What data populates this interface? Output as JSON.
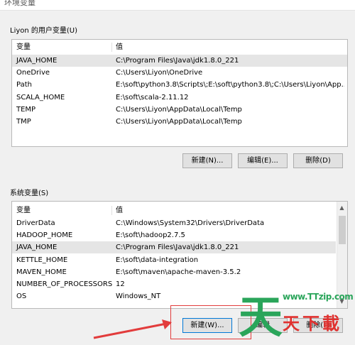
{
  "window": {
    "title": "环境变量"
  },
  "user_vars": {
    "group_label": "Liyon 的用户变量(U)",
    "headers": {
      "name": "变量",
      "value": "值"
    },
    "rows": [
      {
        "name": "JAVA_HOME",
        "value": "C:\\Program Files\\Java\\jdk1.8.0_221",
        "selected": true
      },
      {
        "name": "OneDrive",
        "value": "C:\\Users\\Liyon\\OneDrive",
        "selected": false
      },
      {
        "name": "Path",
        "value": "E:\\soft\\python3.8\\Scripts\\;E:\\soft\\python3.8\\;C:\\Users\\Liyon\\App...",
        "selected": false
      },
      {
        "name": "SCALA_HOME",
        "value": "E:\\soft\\scala-2.11.12",
        "selected": false
      },
      {
        "name": "TEMP",
        "value": "C:\\Users\\Liyon\\AppData\\Local\\Temp",
        "selected": false
      },
      {
        "name": "TMP",
        "value": "C:\\Users\\Liyon\\AppData\\Local\\Temp",
        "selected": false
      }
    ],
    "buttons": {
      "new": "新建(N)...",
      "edit": "编辑(E)...",
      "delete": "删除(D)"
    }
  },
  "system_vars": {
    "group_label": "系统变量(S)",
    "headers": {
      "name": "变量",
      "value": "值"
    },
    "rows": [
      {
        "name": "DriverData",
        "value": "C:\\Windows\\System32\\Drivers\\DriverData",
        "selected": false
      },
      {
        "name": "HADOOP_HOME",
        "value": "E:\\soft\\hadoop2.7.5",
        "selected": false
      },
      {
        "name": "JAVA_HOME",
        "value": "C:\\Program Files\\Java\\jdk1.8.0_221",
        "selected": true
      },
      {
        "name": "KETTLE_HOME",
        "value": "E:\\soft\\data-integration",
        "selected": false
      },
      {
        "name": "MAVEN_HOME",
        "value": "E:\\soft\\maven\\apache-maven-3.5.2",
        "selected": false
      },
      {
        "name": "NUMBER_OF_PROCESSORS",
        "value": "12",
        "selected": false
      },
      {
        "name": "OS",
        "value": "Windows_NT",
        "selected": false
      }
    ],
    "buttons": {
      "new": "新建(W)...",
      "edit": "编辑",
      "delete": "删除(L)"
    }
  },
  "watermark": {
    "char1": "天",
    "char2": "天",
    "char3": "下",
    "char4": "載",
    "url": "www.TTzip.com"
  },
  "colors": {
    "highlight": "#e23c3c",
    "watermark_green": "#2aa55a",
    "watermark_red": "#e0312f"
  }
}
